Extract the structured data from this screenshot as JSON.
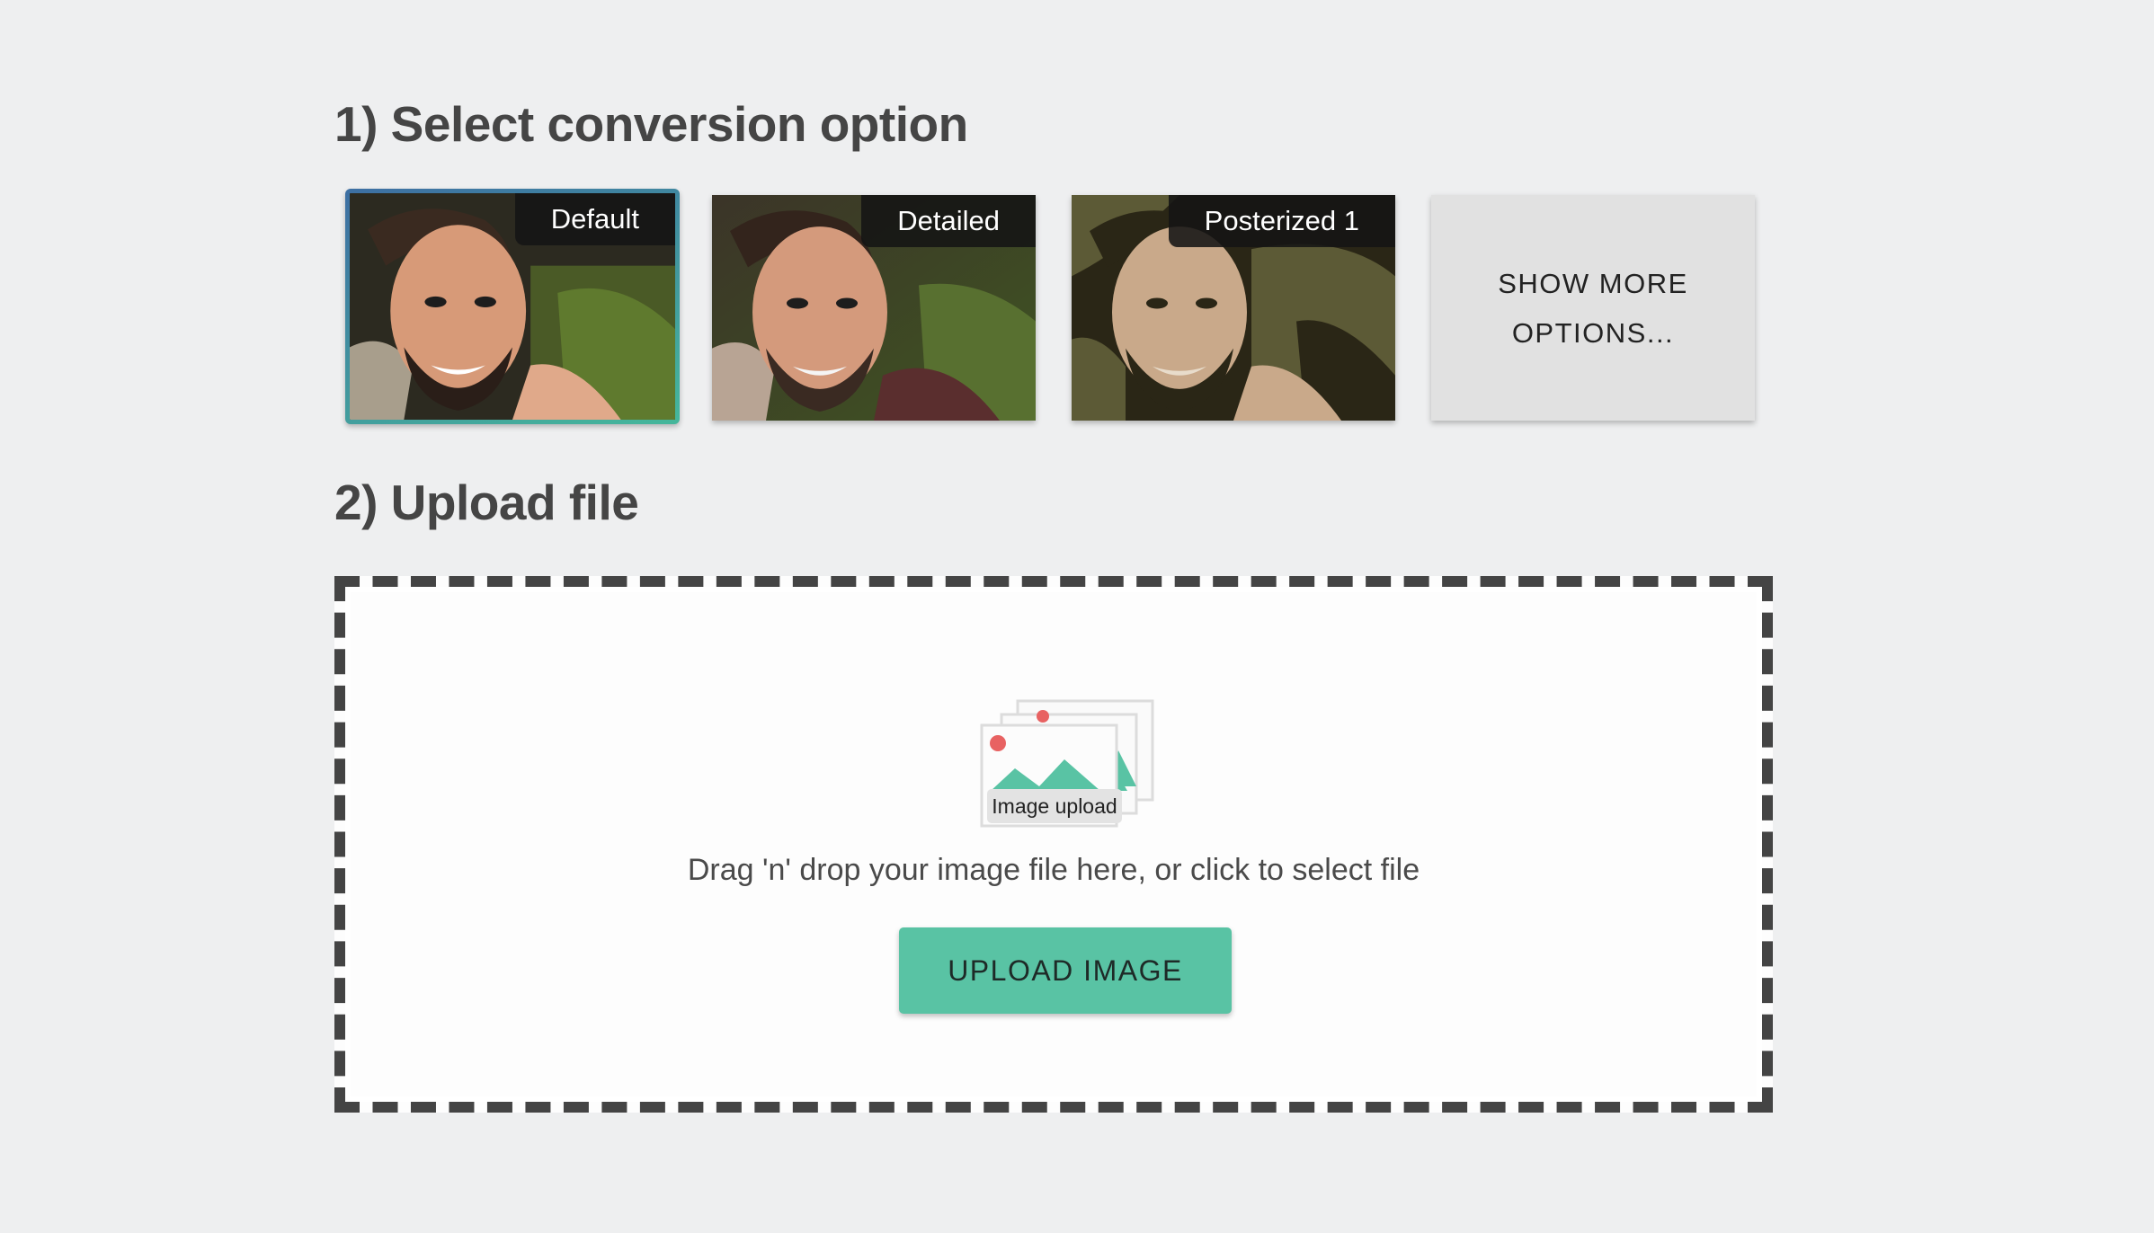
{
  "step1": {
    "title": "1) Select conversion option",
    "options": [
      {
        "label": "Default",
        "selected": true
      },
      {
        "label": "Detailed",
        "selected": false
      },
      {
        "label": "Posterized 1",
        "selected": false
      }
    ],
    "show_more_label": "SHOW MORE OPTIONS..."
  },
  "step2": {
    "title": "2) Upload file",
    "dropzone": {
      "icon_name": "image-upload-icon",
      "icon_caption": "Image upload",
      "instructions": "Drag 'n' drop your image file here, or click to select file",
      "button_label": "UPLOAD IMAGE"
    }
  },
  "colors": {
    "accent": "#59c3a4",
    "selected_border_start": "#3d6fa3",
    "selected_border_end": "#45b79b",
    "background": "#eeeff0"
  }
}
